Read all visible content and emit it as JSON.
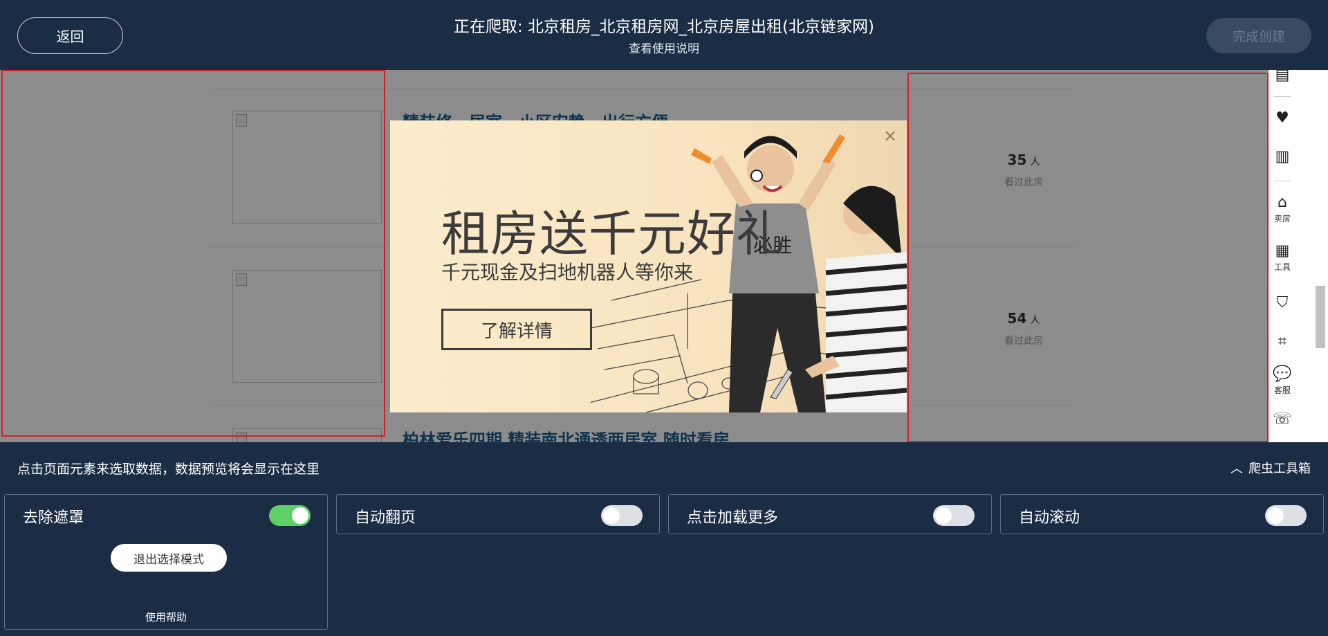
{
  "header": {
    "back_label": "返回",
    "title": "正在爬取: 北京租房_北京租房网_北京房屋出租(北京链家网)",
    "subtitle": "查看使用说明",
    "finish_label": "完成创建"
  },
  "webpage": {
    "listings": [
      {
        "title": "精装修一居室，小区安静，出行方便",
        "views_count": "35",
        "views_unit": "人",
        "views_label": "看过此房"
      },
      {
        "title": "",
        "views_count": "54",
        "views_unit": "人",
        "views_label": "看过此房"
      },
      {
        "title": "柏林爱乐四期 精装南北通透两居室 随时看房",
        "views_count": "",
        "views_unit": "",
        "views_label": ""
      }
    ],
    "side_bar": [
      {
        "icon": "list-icon",
        "label": ""
      },
      {
        "icon": "heart-icon",
        "label": ""
      },
      {
        "icon": "compare-building-icon",
        "label": ""
      },
      {
        "icon": "sell-house-icon",
        "label": "卖房"
      },
      {
        "icon": "tools-grid-icon",
        "label": "工具"
      },
      {
        "icon": "shield-icon",
        "label": ""
      },
      {
        "icon": "scan-icon",
        "label": ""
      },
      {
        "icon": "chat-icon",
        "label": "客服"
      },
      {
        "icon": "phone-icon",
        "label": ""
      }
    ],
    "ad": {
      "title": "租房送千元好礼",
      "subtitle": "千元现金及扫地机器人等你来",
      "button_label": "了解详情"
    }
  },
  "bottom": {
    "hint": "点击页面元素来选取数据，数据预览将会显示在这里",
    "toolbox_label": "爬虫工具箱",
    "options": [
      {
        "label": "去除遮罩",
        "enabled": true
      },
      {
        "label": "自动翻页",
        "enabled": false
      },
      {
        "label": "点击加载更多",
        "enabled": false
      },
      {
        "label": "自动滚动",
        "enabled": false
      }
    ],
    "exit_label": "退出选择模式",
    "help_label": "使用帮助"
  },
  "colors": {
    "background": "#1a2d45",
    "toggle_on": "#5fcf68",
    "selection_border": "#d0202a",
    "listing_title": "#1b5d8c"
  }
}
